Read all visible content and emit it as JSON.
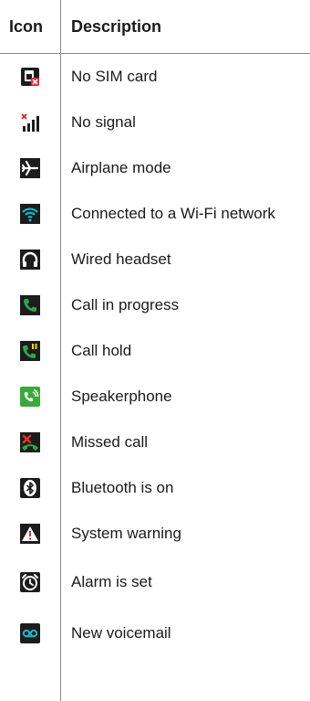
{
  "table": {
    "header": {
      "icon": "Icon",
      "description": "Description"
    },
    "rows": [
      {
        "icon": "no-sim-card-icon",
        "label": "No SIM card"
      },
      {
        "icon": "no-signal-icon",
        "label": "No signal"
      },
      {
        "icon": "airplane-mode-icon",
        "label": "Airplane mode"
      },
      {
        "icon": "wifi-icon",
        "label": "Connected to a Wi-Fi network"
      },
      {
        "icon": "headset-icon",
        "label": "Wired headset"
      },
      {
        "icon": "call-in-progress-icon",
        "label": "Call in progress"
      },
      {
        "icon": "call-hold-icon",
        "label": "Call hold"
      },
      {
        "icon": "speakerphone-icon",
        "label": "Speakerphone"
      },
      {
        "icon": "missed-call-icon",
        "label": "Missed call"
      },
      {
        "icon": "bluetooth-icon",
        "label": "Bluetooth is on"
      },
      {
        "icon": "warning-icon",
        "label": "System warning"
      },
      {
        "icon": "alarm-icon",
        "label": "Alarm is set"
      },
      {
        "icon": "voicemail-icon",
        "label": "New voicemail"
      }
    ]
  },
  "colors": {
    "green": "#2aa84a",
    "red": "#e5302a",
    "cyan": "#16b6c8",
    "dark": "#1c1c1c"
  }
}
